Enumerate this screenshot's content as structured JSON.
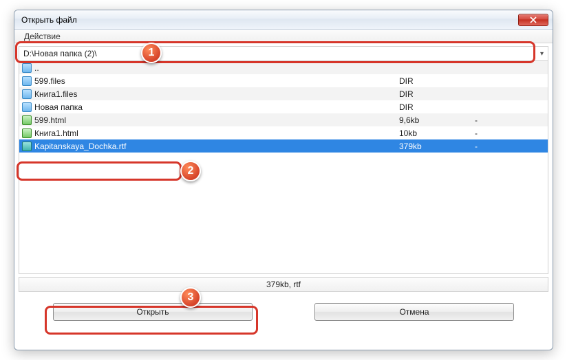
{
  "window": {
    "title": "Открыть файл",
    "menu": {
      "action": "Действие"
    },
    "path": "D:\\Новая папка (2)\\",
    "status": "379kb, rtf",
    "buttons": {
      "open": "Открыть",
      "cancel": "Отмена"
    }
  },
  "files": [
    {
      "name": "..",
      "size": "",
      "extra": "",
      "type": "folder",
      "stripe": true,
      "selected": false
    },
    {
      "name": "599.files",
      "size": "DIR",
      "extra": "",
      "type": "folder",
      "stripe": false,
      "selected": false
    },
    {
      "name": "Книга1.files",
      "size": "DIR",
      "extra": "",
      "type": "folder",
      "stripe": true,
      "selected": false
    },
    {
      "name": "Новая папка",
      "size": "DIR",
      "extra": "",
      "type": "folder",
      "stripe": false,
      "selected": false
    },
    {
      "name": "599.html",
      "size": "9,6kb",
      "extra": "-",
      "type": "doc",
      "stripe": true,
      "selected": false
    },
    {
      "name": "Книга1.html",
      "size": "10kb",
      "extra": "-",
      "type": "doc",
      "stripe": false,
      "selected": false
    },
    {
      "name": "Kapitanskaya_Dochka.rtf",
      "size": "379kb",
      "extra": "-",
      "type": "rtf",
      "stripe": false,
      "selected": true
    }
  ],
  "badges": {
    "1": "1",
    "2": "2",
    "3": "3"
  }
}
